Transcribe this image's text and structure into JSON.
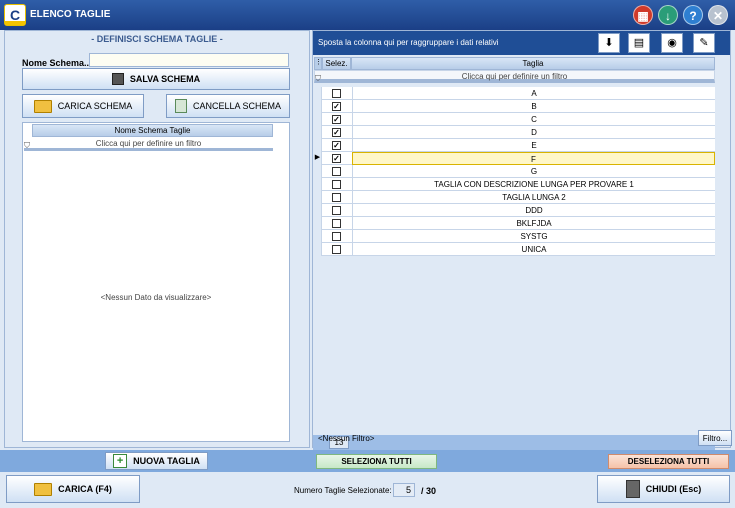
{
  "window": {
    "title": "ELENCO TAGLIE",
    "logo_letter": "C",
    "buttons": {
      "calc": "▦",
      "download": "↓",
      "help": "?",
      "close": "✕"
    }
  },
  "left": {
    "panel_title": "- DEFINISCI SCHEMA TAGLIE -",
    "name_label": "Nome Schema..",
    "name_value": "",
    "save_label": "SALVA SCHEMA",
    "load_schema_label": "CARICA SCHEMA",
    "delete_schema_label": "CANCELLA SCHEMA",
    "grid_header": "Nome Schema Taglie",
    "filter_hint": "Clicca qui per definire un filtro",
    "empty_text": "<Nessun Dato da visualizzare>"
  },
  "right": {
    "group_hint": "Sposta la colonna qui per raggruppare i dati relativi",
    "col_sel": "Selez.",
    "col_taglia": "Taglia",
    "filter_hint": "Clicca qui per definire un filtro",
    "rows": [
      {
        "label": "A",
        "checked": false,
        "current": false
      },
      {
        "label": "B",
        "checked": true,
        "current": false
      },
      {
        "label": "C",
        "checked": true,
        "current": false
      },
      {
        "label": "D",
        "checked": true,
        "current": false
      },
      {
        "label": "E",
        "checked": true,
        "current": false
      },
      {
        "label": "F",
        "checked": true,
        "current": true
      },
      {
        "label": "G",
        "checked": false,
        "current": false
      },
      {
        "label": "TAGLIA CON DESCRIZIONE LUNGA PER PROVARE 1",
        "checked": false,
        "current": false
      },
      {
        "label": "TAGLIA LUNGA 2",
        "checked": false,
        "current": false
      },
      {
        "label": "DDD",
        "checked": false,
        "current": false
      },
      {
        "label": "BKLFJDA",
        "checked": false,
        "current": false
      },
      {
        "label": "SYSTG",
        "checked": false,
        "current": false
      },
      {
        "label": "UNICA",
        "checked": false,
        "current": false
      }
    ],
    "row_count": "13",
    "filter_status": "<Nessun Filtro>",
    "filter_button": "Filtro..."
  },
  "actions": {
    "new_size": "NUOVA TAGLIA",
    "select_all": "SELEZIONA TUTTI",
    "deselect_all": "DESELEZIONA TUTTI"
  },
  "footer": {
    "load": "CARICA (F4)",
    "close": "CHIUDI  (Esc)",
    "selected_label": "Numero Taglie Selezionate:",
    "selected_count": "5",
    "selected_total": "/ 30"
  }
}
